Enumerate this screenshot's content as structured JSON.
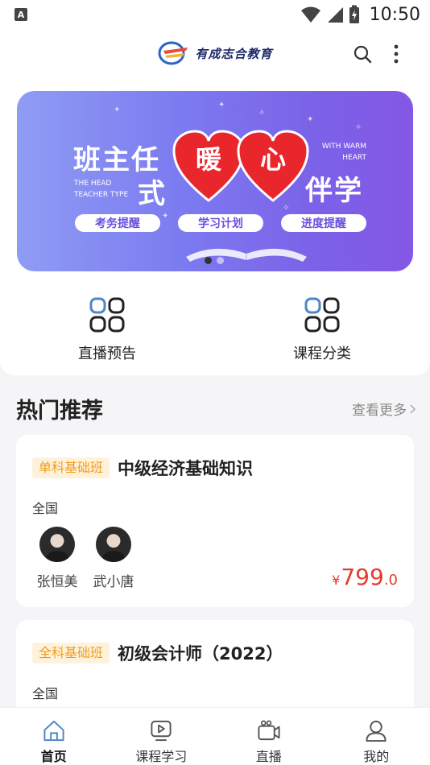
{
  "status_bar": {
    "notification_badge": "A",
    "time": "10:50"
  },
  "header": {
    "logo_text": "有成志合教育"
  },
  "banner": {
    "title_line1": "班主任",
    "title_line2": "式",
    "heart_words": [
      "暖",
      "心"
    ],
    "title_right": "伴学",
    "en_left": "THE HEAD TEACHER TYPE",
    "en_right": "WITH WARM HEART",
    "pills": [
      "考务提醒",
      "学习计划",
      "进度提醒"
    ],
    "dots_total": 2,
    "dots_active": 1
  },
  "quick_entries": [
    {
      "label": "直播预告",
      "icon": "grid-icon"
    },
    {
      "label": "课程分类",
      "icon": "grid-icon"
    }
  ],
  "recommend": {
    "title": "热门推荐",
    "see_more": "查看更多"
  },
  "courses": [
    {
      "tag": "单科基础班",
      "title": "中级经济基础知识",
      "region": "全国",
      "teachers": [
        "张恒美",
        "武小唐"
      ],
      "price_currency": "¥",
      "price_int": "799",
      "price_dec": ".0"
    },
    {
      "tag": "全科基础班",
      "title": "初级会计师（2022）",
      "region": "全国"
    }
  ],
  "tabs": [
    {
      "label": "首页",
      "icon": "home-icon",
      "active": true
    },
    {
      "label": "课程学习",
      "icon": "play-icon",
      "active": false
    },
    {
      "label": "直播",
      "icon": "camera-icon",
      "active": false
    },
    {
      "label": "我的",
      "icon": "user-icon",
      "active": false
    }
  ],
  "colors": {
    "accent": "#4f86c6",
    "price": "#e53b2c",
    "tag_bg": "#fff2dc",
    "tag_text": "#f39b1a",
    "banner_start": "#8f9cf4",
    "banner_end": "#8457e6"
  }
}
